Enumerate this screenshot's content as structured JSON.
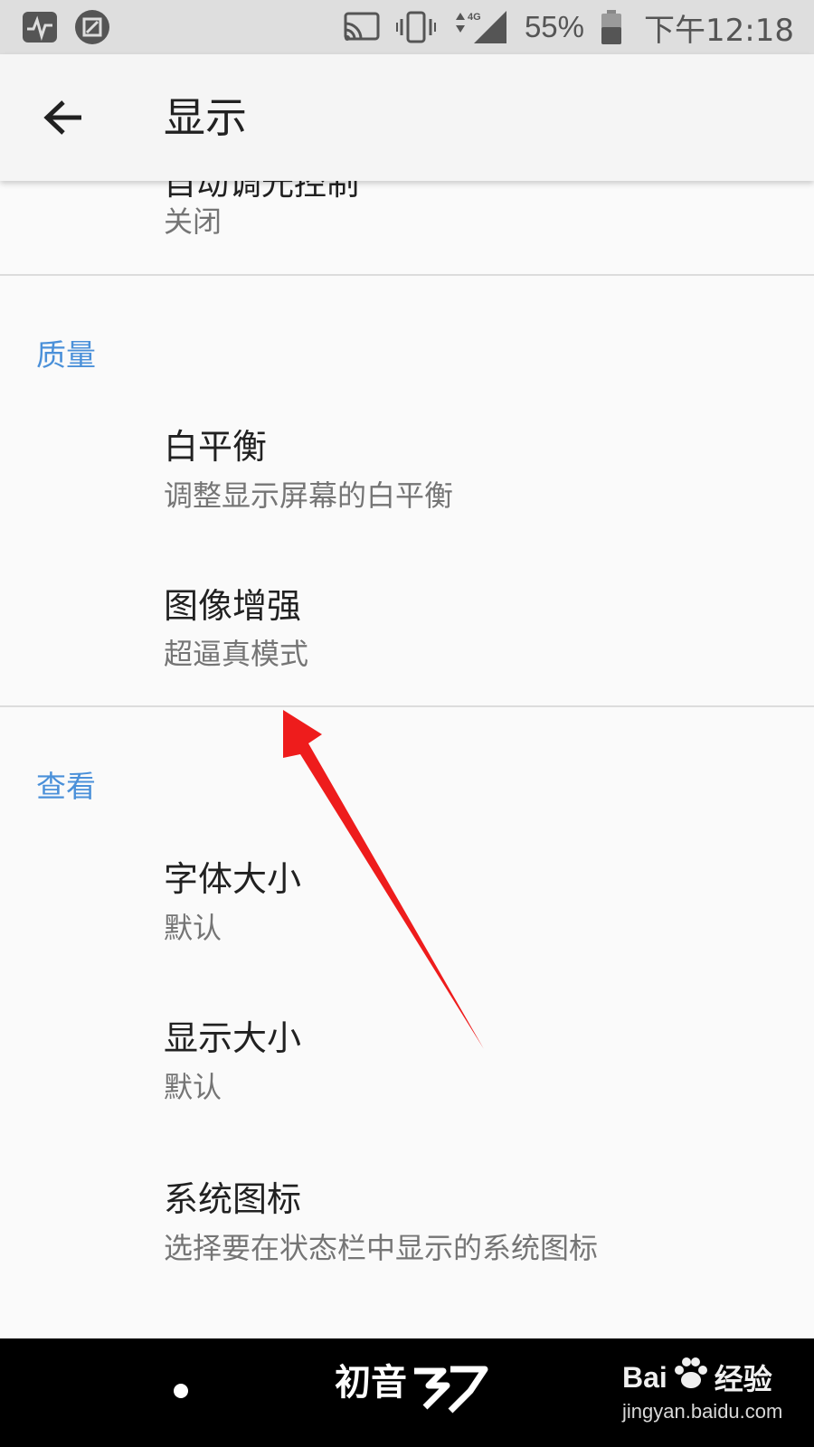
{
  "status_bar": {
    "battery": "55%",
    "time": "下午12:18",
    "network": "4G"
  },
  "app_bar": {
    "title": "显示"
  },
  "list": {
    "partial_title": "自动调光控制",
    "partial_summary": "关闭",
    "sections": [
      {
        "category": "质量",
        "items": [
          {
            "title": "白平衡",
            "summary": "调整显示屏幕的白平衡"
          },
          {
            "title": "图像增强",
            "summary": "超逼真模式"
          }
        ]
      },
      {
        "category": "查看",
        "items": [
          {
            "title": "字体大小",
            "summary": "默认"
          },
          {
            "title": "显示大小",
            "summary": "默认"
          },
          {
            "title": "系统图标",
            "summary": "选择要在状态栏中显示的系统图标"
          }
        ]
      }
    ]
  },
  "watermarks": {
    "middle": "初音",
    "brand": "Bai",
    "brand_cn": "经验",
    "site": "jingyan.baidu.com"
  },
  "colors": {
    "accent": "#4a90d9",
    "annotation": "#ee1c1c"
  }
}
